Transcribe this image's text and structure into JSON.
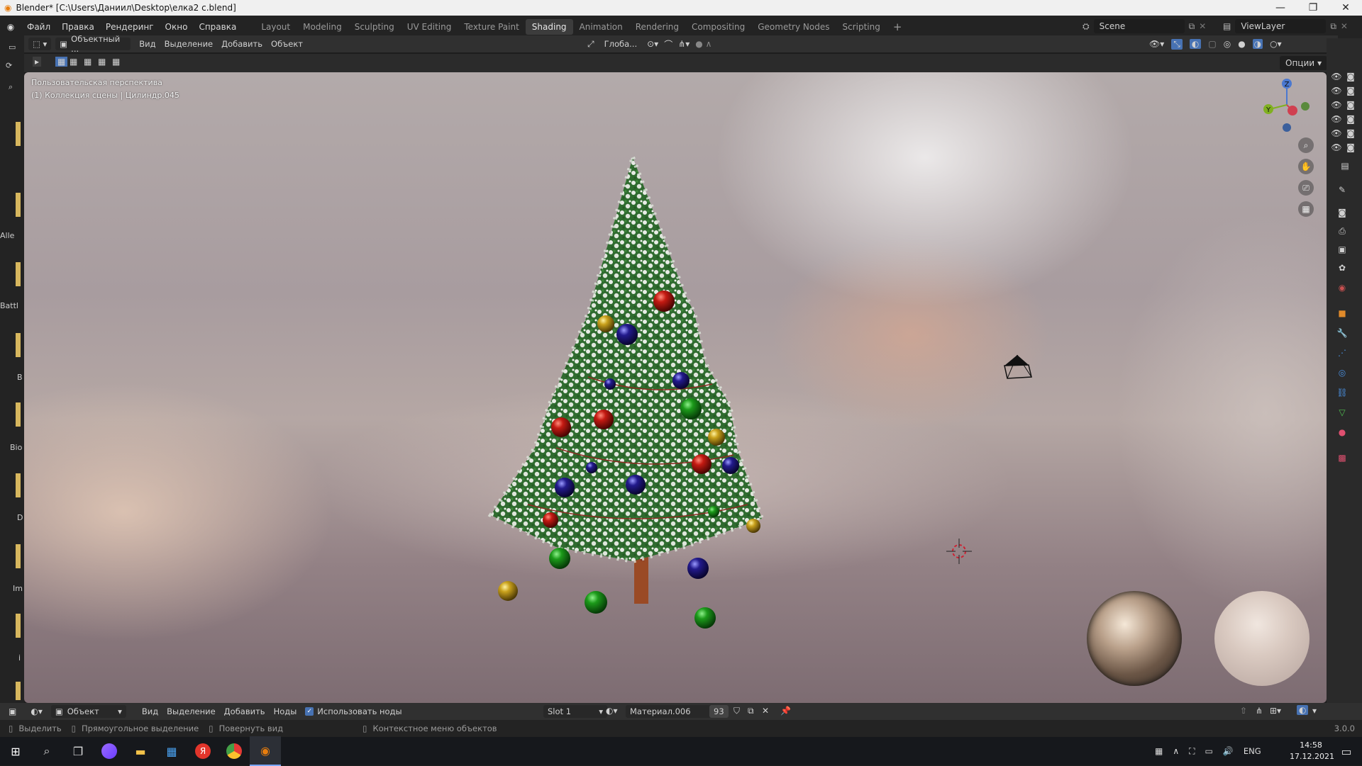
{
  "window": {
    "title": "Blender* [C:\\Users\\Даниил\\Desktop\\елка2 c.blend]"
  },
  "menu": [
    "Файл",
    "Правка",
    "Рендеринг",
    "Окно",
    "Справка"
  ],
  "workspaces": [
    "Layout",
    "Modeling",
    "Sculpting",
    "UV Editing",
    "Texture Paint",
    "Shading",
    "Animation",
    "Rendering",
    "Compositing",
    "Geometry Nodes",
    "Scripting"
  ],
  "active_workspace": "Shading",
  "add_tab": "+",
  "scene": {
    "name": "Scene"
  },
  "view_layer": {
    "name": "ViewLayer"
  },
  "viewport_header": {
    "mode": "Объектный ...",
    "items": [
      "Вид",
      "Выделение",
      "Добавить",
      "Объект"
    ],
    "transform": "Глоба...",
    "options": "Опции"
  },
  "viewport": {
    "perspective": "Пользовательская перспектива",
    "collection": "(1) Коллекция сцены | Цилиндр.045"
  },
  "gizmo": {
    "z": "Z",
    "y": "Y"
  },
  "asset_sidebar": [
    "Alle",
    "Battl",
    "B",
    "Bio",
    "D",
    "Im",
    "i"
  ],
  "node_header": {
    "mode": "Объект",
    "items": [
      "Вид",
      "Выделение",
      "Добавить",
      "Ноды"
    ],
    "use_nodes": "Использовать ноды",
    "use_nodes_checked": true,
    "slot": "Slot 1",
    "material": "Материал.006",
    "users": "93"
  },
  "version": "3.0.0",
  "statusbar": {
    "select": "Выделить",
    "box_select": "Прямоугольное выделение",
    "rotate": "Повернуть вид",
    "context_menu": "Контекстное меню объектов"
  },
  "taskbar": {
    "lang": "ENG",
    "time": "14:58",
    "date": "17.12.2021"
  },
  "colors": {
    "accent": "#4772b3",
    "active_tab": "#3c3c3c",
    "asset_bar": "#d7b75e"
  }
}
